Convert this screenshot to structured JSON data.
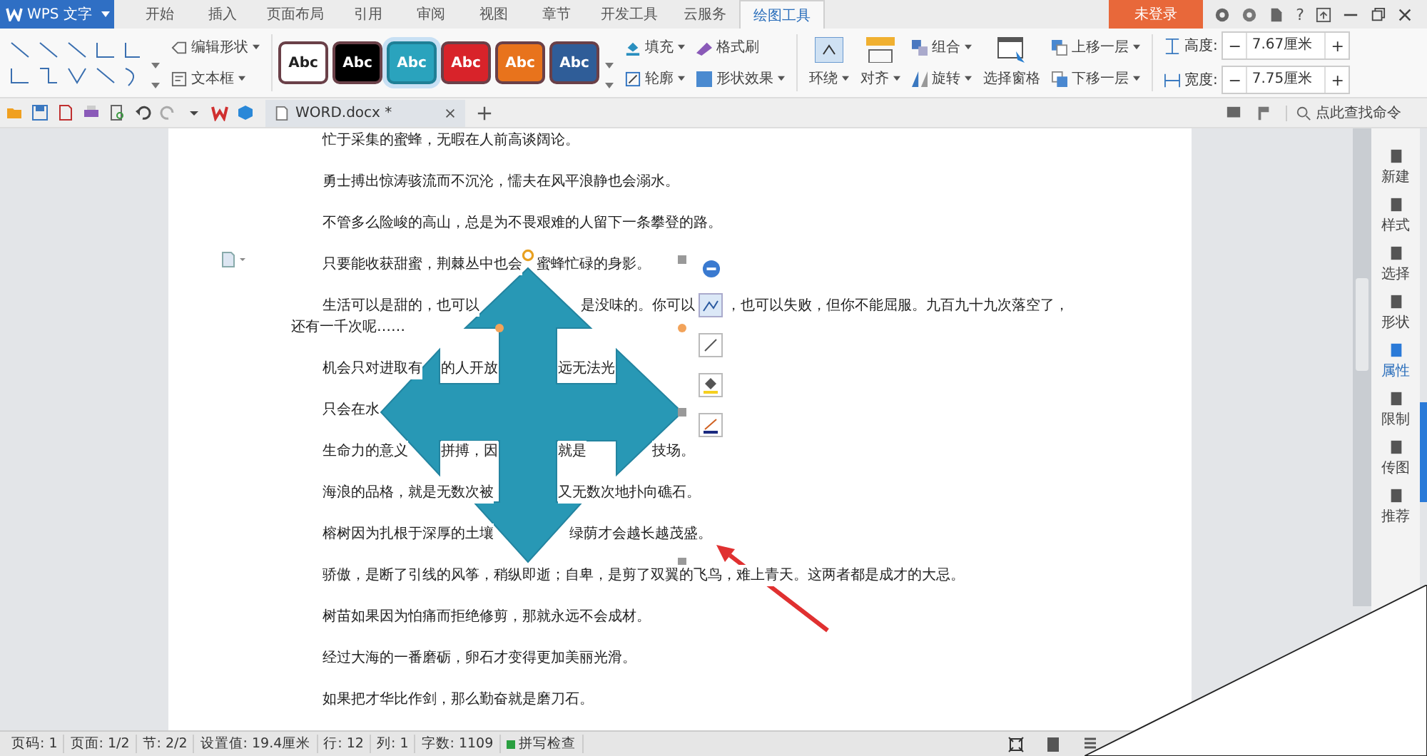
{
  "app_button": {
    "label": "WPS 文字"
  },
  "menu_tabs": [
    {
      "label": "开始",
      "selected": false
    },
    {
      "label": "插入",
      "selected": false
    },
    {
      "label": "页面布局",
      "selected": false
    },
    {
      "label": "引用",
      "selected": false
    },
    {
      "label": "审阅",
      "selected": false
    },
    {
      "label": "视图",
      "selected": false
    },
    {
      "label": "章节",
      "selected": false
    },
    {
      "label": "开发工具",
      "selected": false
    },
    {
      "label": "云服务",
      "selected": false
    },
    {
      "label": "绘图工具",
      "selected": true
    }
  ],
  "login_button": {
    "label": "未登录"
  },
  "help_button": {
    "label": "?"
  },
  "ribbon": {
    "edit_shape": "编辑形状",
    "text_box": "文本框",
    "styles": [
      {
        "label": "Abc",
        "color": "#ffffff",
        "selected": false
      },
      {
        "label": "Abc",
        "color": "#000000",
        "selected": false
      },
      {
        "label": "Abc",
        "color": "#2aa3bd",
        "selected": true
      },
      {
        "label": "Abc",
        "color": "#d8232a",
        "selected": false
      },
      {
        "label": "Abc",
        "color": "#e8731c",
        "selected": false
      },
      {
        "label": "Abc",
        "color": "#2f5d98",
        "selected": false
      }
    ],
    "fill": "填充",
    "format_painter": "格式刷",
    "outline": "轮廓",
    "shape_effects": "形状效果",
    "wrap": "环绕",
    "align": "对齐",
    "group": "组合",
    "rotate": "旋转",
    "selection_pane": "选择窗格",
    "bring_forward": "上移一层",
    "send_backward": "下移一层",
    "size_fields": [
      {
        "label": "高度:",
        "value": "7.67厘米",
        "minus": "−",
        "plus": "+"
      },
      {
        "label": "宽度:",
        "value": "7.75厘米",
        "minus": "−",
        "plus": "+"
      }
    ]
  },
  "doc_tabs": [
    {
      "label": "WORD.docx *",
      "selected": true
    }
  ],
  "command_search": {
    "placeholder": "点此查找命令"
  },
  "paragraphs": [
    {
      "parts": [
        "忙于采集的蜜蜂，无暇在人前高谈阔论。"
      ]
    },
    {
      "parts": [
        "勇士搏出惊涛骇流而不沉沦，懦夫在风平浪静也会溺水。"
      ]
    },
    {
      "parts": [
        "不管多么险峻的高山，总是为不畏艰难的人留下一条攀登的路。"
      ]
    },
    {
      "parts": [
        "只要能收获甜蜜，荆棘丛中也会",
        "蜜蜂忙碌的身影。"
      ]
    },
    {
      "parts": [
        "生活可以是甜的，也可以",
        "是没味的。你可以",
        "，也可以失败，但你不能屈服。九百九十九次落空了，"
      ],
      "wrap": "还有一千次呢……"
    },
    {
      "parts": [
        "机会只对进取有",
        "的人开放",
        "远无法光"
      ]
    },
    {
      "parts": [
        "只会在水"
      ]
    },
    {
      "parts": [
        "生命力的意义",
        "拼搏，因",
        "就是",
        "技场。"
      ]
    },
    {
      "parts": [
        "海浪的品格，就是无数次被",
        "又无数次地扑向礁石。"
      ]
    },
    {
      "parts": [
        "榕树因为扎根于深厚的土壤",
        "绿荫才会越长越茂盛。"
      ]
    },
    {
      "parts": [
        "骄傲，是断了引线的风筝，稍纵即逝；自卑，是剪了双翼的飞鸟，难上青天。这两者都是成才的大忌。"
      ]
    },
    {
      "parts": [
        "树苗如果因为怕痛而拒绝修剪，那就永远不会成材。"
      ]
    },
    {
      "parts": [
        "经过大海的一番磨砺，卵石才变得更加美丽光滑。"
      ]
    },
    {
      "parts": [
        "如果把才华比作剑，那么勤奋就是磨刀石。"
      ]
    }
  ],
  "side_panel": [
    {
      "label": "新建",
      "selected": false
    },
    {
      "label": "样式",
      "selected": false
    },
    {
      "label": "选择",
      "selected": false
    },
    {
      "label": "形状",
      "selected": false
    },
    {
      "label": "属性",
      "selected": true
    },
    {
      "label": "限制",
      "selected": false
    },
    {
      "label": "传图",
      "selected": false
    },
    {
      "label": "推荐",
      "selected": false
    }
  ],
  "status_bar": [
    {
      "text": "页码: 1"
    },
    {
      "text": "页面: 1/2"
    },
    {
      "text": "节: 2/2"
    },
    {
      "text": "设置值: 19.4厘米"
    },
    {
      "text": "行: 12"
    },
    {
      "text": "列: 1"
    },
    {
      "text": "字数: 1109"
    }
  ],
  "spell_check": {
    "label": "拼写检查",
    "on": true
  }
}
